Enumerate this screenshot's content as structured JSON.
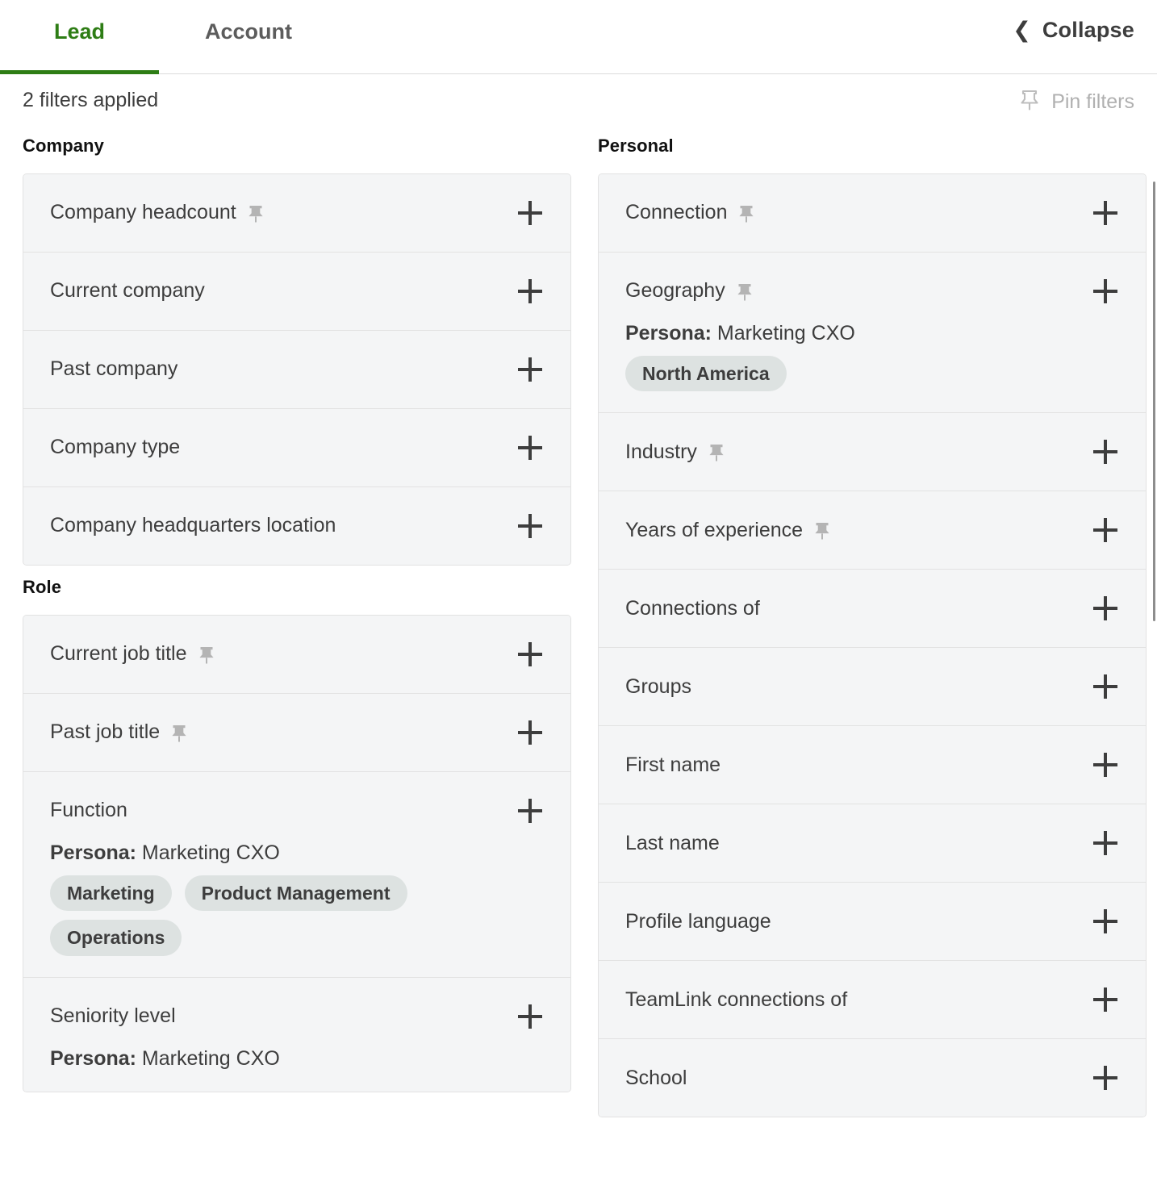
{
  "header": {
    "tabs": [
      {
        "label": "Lead",
        "active": true
      },
      {
        "label": "Account",
        "active": false
      }
    ],
    "collapse": {
      "label": "Collapse",
      "icon": "chevron-left-icon",
      "glyph": "❮"
    }
  },
  "filter_bar": {
    "applied_text": "2 filters applied",
    "pin_filters_label": "Pin filters",
    "pin_filters_icon": "pin-outline-icon"
  },
  "colors": {
    "accent_green": "#2e7d15",
    "row_background": "#f4f5f6",
    "row_border": "#e2e2e2",
    "tag_background": "#dde2e1",
    "text_primary": "#3d3d3d",
    "text_muted": "#b0b0b0",
    "pin_icon": "#b4b4b4"
  },
  "left_column": {
    "groups": [
      {
        "title": "Company",
        "rows": [
          {
            "label": "Company headcount",
            "pinned": true,
            "add_label": "+"
          },
          {
            "label": "Current company",
            "pinned": false,
            "add_label": "+"
          },
          {
            "label": "Past company",
            "pinned": false,
            "add_label": "+"
          },
          {
            "label": "Company type",
            "pinned": false,
            "add_label": "+"
          },
          {
            "label": "Company headquarters location",
            "pinned": false,
            "add_label": "+"
          }
        ]
      },
      {
        "title": "Role",
        "rows": [
          {
            "label": "Current job title",
            "pinned": true,
            "add_label": "+"
          },
          {
            "label": "Past job title",
            "pinned": true,
            "add_label": "+"
          },
          {
            "label": "Function",
            "pinned": false,
            "add_label": "+",
            "persona_label": "Persona:",
            "persona_value": "Marketing CXO",
            "tags": [
              "Marketing",
              "Product Management",
              "Operations"
            ]
          },
          {
            "label": "Seniority level",
            "pinned": false,
            "add_label": "+",
            "persona_label": "Persona:",
            "persona_value": "Marketing CXO"
          }
        ]
      }
    ]
  },
  "right_column": {
    "groups": [
      {
        "title": "Personal",
        "rows": [
          {
            "label": "Connection",
            "pinned": true,
            "add_label": "+"
          },
          {
            "label": "Geography",
            "pinned": true,
            "add_label": "+",
            "persona_label": "Persona:",
            "persona_value": "Marketing CXO",
            "tags": [
              "North America"
            ]
          },
          {
            "label": "Industry",
            "pinned": true,
            "add_label": "+"
          },
          {
            "label": "Years of experience",
            "pinned": true,
            "add_label": "+"
          },
          {
            "label": "Connections of",
            "pinned": false,
            "add_label": "+"
          },
          {
            "label": "Groups",
            "pinned": false,
            "add_label": "+"
          },
          {
            "label": "First name",
            "pinned": false,
            "add_label": "+"
          },
          {
            "label": "Last name",
            "pinned": false,
            "add_label": "+"
          },
          {
            "label": "Profile language",
            "pinned": false,
            "add_label": "+"
          },
          {
            "label": "TeamLink connections of",
            "pinned": false,
            "add_label": "+"
          },
          {
            "label": "School",
            "pinned": false,
            "add_label": "+"
          }
        ]
      }
    ]
  }
}
